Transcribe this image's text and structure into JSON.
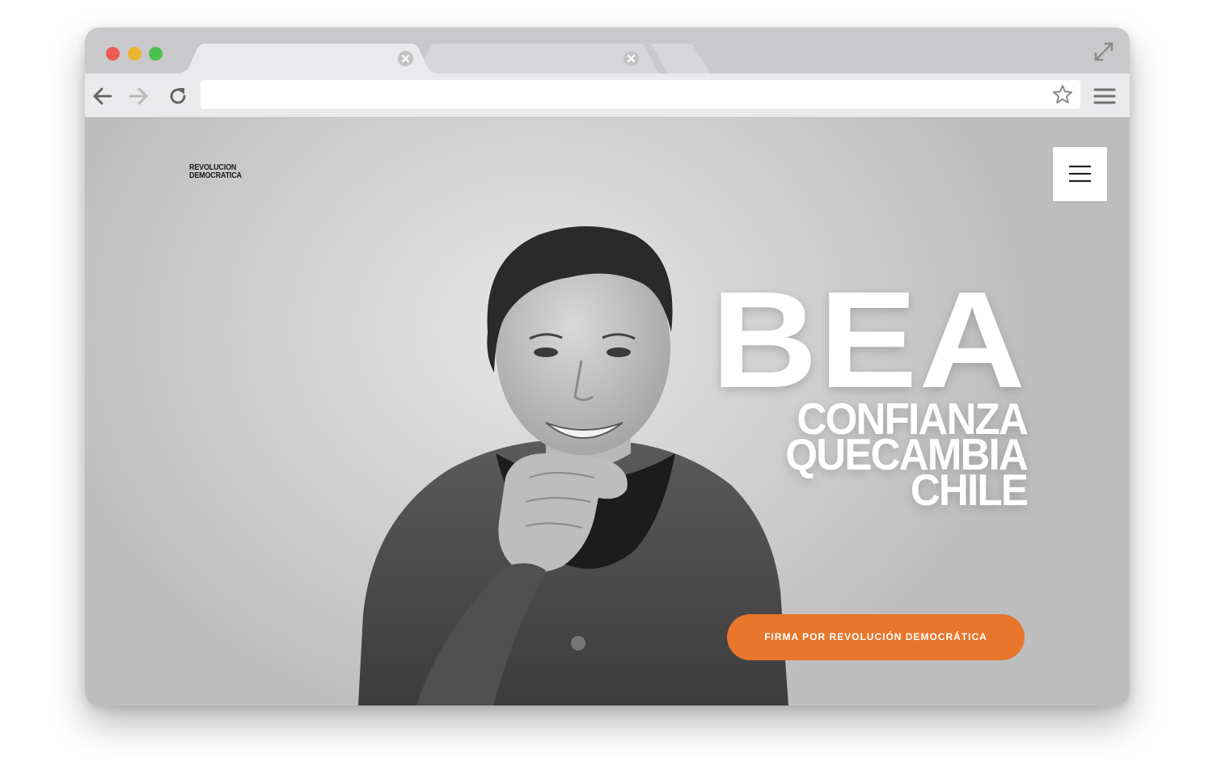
{
  "browser": {
    "window_controls": [
      "close",
      "minimize",
      "maximize"
    ],
    "colors": {
      "close": "#ed5b55",
      "minimize": "#e8b62e",
      "maximize": "#4cc04f"
    },
    "tabs": [
      {
        "label": "",
        "active": true
      },
      {
        "label": "",
        "active": false
      }
    ],
    "address": "",
    "icons": {
      "back": "arrow-left-icon",
      "forward": "arrow-right-icon",
      "reload": "reload-icon",
      "bookmark": "star-icon",
      "menu": "hamburger-icon",
      "expand": "expand-icon"
    }
  },
  "site": {
    "logo": {
      "line1": "REVOLUCION",
      "line2": "DEMOCRATICA"
    },
    "menu_icon": "hamburger-icon",
    "headline": "BEA",
    "tagline": [
      "CONFIANZA",
      "QUECAMBIA",
      "CHILE"
    ],
    "cta_label": "FIRMA POR REVOLUCIÓN DEMOCRÁTICA",
    "accent_color": "#e8762b"
  }
}
